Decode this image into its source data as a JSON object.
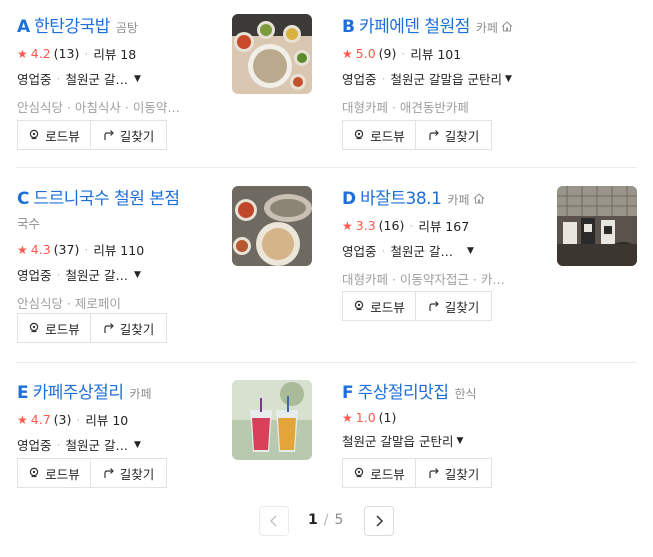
{
  "places": [
    {
      "letter": "A",
      "name": "한탄강국밥",
      "category": "곰탕",
      "subcategory": "",
      "rating": "4.2",
      "rating_count": "(13)",
      "reviews": "리뷰 18",
      "status": "영업중",
      "address": "철원군 갈…",
      "tags": "안심식당 · 아침식사 · 이동약…",
      "road_label": "로드뷰",
      "route_label": "길찾기"
    },
    {
      "letter": "B",
      "name": "카페에덴 철원점",
      "category": "카페",
      "subcategory": "",
      "rating": "5.0",
      "rating_count": "(9)",
      "reviews": "리뷰 101",
      "status": "영업중",
      "address": "철원군 갈말읍 군탄리",
      "tags": "대형카페 · 애견동반카페",
      "road_label": "로드뷰",
      "route_label": "길찾기"
    },
    {
      "letter": "C",
      "name": "드르니국수 철원 본점",
      "category": "",
      "subcategory": "국수",
      "rating": "4.3",
      "rating_count": "(37)",
      "reviews": "리뷰 110",
      "status": "영업중",
      "address": "철원군 갈…",
      "tags": "안심식당 · 제로페이",
      "road_label": "로드뷰",
      "route_label": "길찾기"
    },
    {
      "letter": "D",
      "name": "바잘트38.1",
      "category": "카페",
      "subcategory": "",
      "rating": "3.3",
      "rating_count": "(16)",
      "reviews": "리뷰 167",
      "status": "영업중",
      "address": "철원군 갈…",
      "tags": "대형카페 · 이동약자접근 · 카…",
      "road_label": "로드뷰",
      "route_label": "길찾기"
    },
    {
      "letter": "E",
      "name": "카페주상절리",
      "category": "카페",
      "subcategory": "",
      "rating": "4.7",
      "rating_count": "(3)",
      "reviews": "리뷰 10",
      "status": "영업중",
      "address": "철원군 갈…",
      "tags": "",
      "road_label": "로드뷰",
      "route_label": "길찾기"
    },
    {
      "letter": "F",
      "name": "주상절리맛집",
      "category": "한식",
      "subcategory": "",
      "rating": "1.0",
      "rating_count": "(1)",
      "reviews": "",
      "status": "",
      "address": "철원군 갈말읍 군탄리",
      "tags": "",
      "road_label": "로드뷰",
      "route_label": "길찾기"
    }
  ],
  "pagination": {
    "current": "1",
    "separator": "/",
    "total": "5"
  },
  "colors": {
    "title_blue": "#1e6fd9",
    "rating_red": "#ff5a4e",
    "muted": "#8f8f8f"
  }
}
